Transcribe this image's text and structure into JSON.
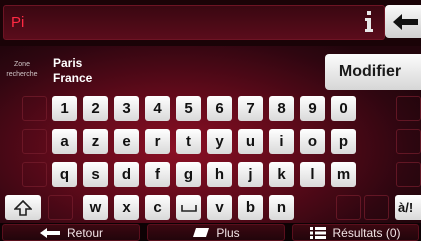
{
  "search": {
    "text": "Pi"
  },
  "location": {
    "zone_label": "Zone recherche",
    "city": "Paris",
    "country": "France",
    "modify_label": "Modifier"
  },
  "keyboard": {
    "row1": [
      "1",
      "2",
      "3",
      "4",
      "5",
      "6",
      "7",
      "8",
      "9",
      "0"
    ],
    "row2": [
      "a",
      "z",
      "e",
      "r",
      "t",
      "y",
      "u",
      "i",
      "o",
      "p"
    ],
    "row3": [
      "q",
      "s",
      "d",
      "f",
      "g",
      "h",
      "j",
      "k",
      "l",
      "m"
    ],
    "row4": [
      "w",
      "x",
      "c",
      "v",
      "b",
      "n"
    ],
    "accent_key": "à/!"
  },
  "bottom": {
    "back_label": "Retour",
    "more_label": "Plus",
    "results_label": "Résultats (0)"
  },
  "colors": {
    "accent": "#ff2a43",
    "key_bg": "#f2f2f2",
    "background": "#5e0a1a"
  },
  "icons": [
    "info-icon",
    "backspace-icon",
    "shift-icon",
    "space-icon",
    "arrow-left-icon",
    "more-icon",
    "list-icon"
  ]
}
